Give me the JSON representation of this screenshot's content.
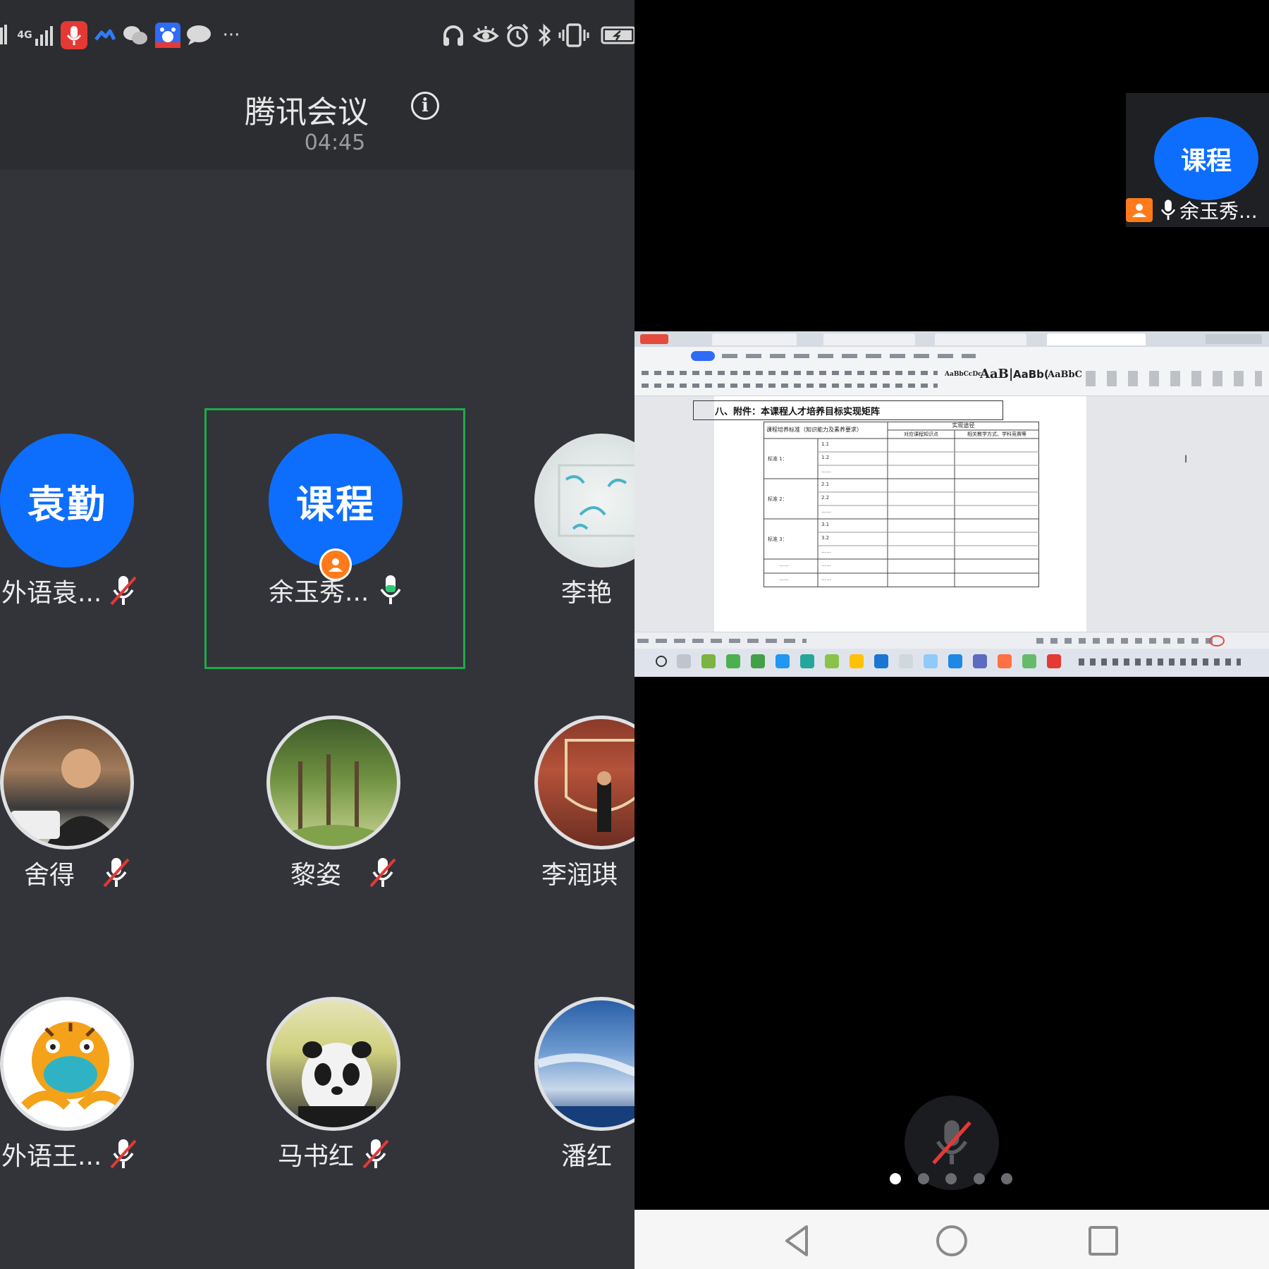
{
  "status_bar": {
    "network": "4G",
    "more": "···"
  },
  "meeting": {
    "title": "腾讯会议",
    "elapsed": "04:45"
  },
  "participants": [
    {
      "name": "外语袁...",
      "avatar_text": "袁勤",
      "mic": "muted"
    },
    {
      "name": "余玉秀...",
      "avatar_text": "课程",
      "mic": "on",
      "host": true,
      "speaking": true
    },
    {
      "name": "李艳",
      "avatar_text": "",
      "mic": "none"
    },
    {
      "name": "舍得",
      "avatar_text": "",
      "mic": "muted"
    },
    {
      "name": "黎姿",
      "avatar_text": "",
      "mic": "muted"
    },
    {
      "name": "李润琪",
      "avatar_text": "",
      "mic": "none"
    },
    {
      "name": "外语王...",
      "avatar_text": "",
      "mic": "muted"
    },
    {
      "name": "马书红",
      "avatar_text": "",
      "mic": "muted"
    },
    {
      "name": "潘红",
      "avatar_text": "",
      "mic": "none"
    }
  ],
  "pip": {
    "avatar_text": "课程",
    "name": "余玉秀..."
  },
  "shared_document": {
    "heading": "八、附件：本课程人才培养目标实现矩阵",
    "table_header_col1": "课程培养标准（知识能力及素养要求）",
    "table_header_group": "实现途径",
    "table_header_col2": "对应课程知识点",
    "table_header_col3": "相关教学方式、学科竞赛等",
    "rows": [
      {
        "standard": "标准 1：",
        "items": [
          "1.1",
          "1.2",
          "……"
        ]
      },
      {
        "standard": "标准 2：",
        "items": [
          "2.1",
          "2.2",
          "……"
        ]
      },
      {
        "standard": "标准 3：",
        "items": [
          "3.1",
          "3.2",
          "……"
        ]
      },
      {
        "standard": "……",
        "items": [
          "……"
        ]
      },
      {
        "standard": "……",
        "items": [
          "……"
        ]
      }
    ],
    "ribbon_styles": [
      "AaBbCcDc",
      "AaB|",
      "AaBb(",
      "AaBbC"
    ]
  },
  "pagination": {
    "pages": 5,
    "current": 0
  },
  "colors": {
    "accent_blue": "#0d6efd",
    "active_green": "#1faa4a",
    "host_orange": "#ff7a1a",
    "muted_red": "#e53935"
  }
}
